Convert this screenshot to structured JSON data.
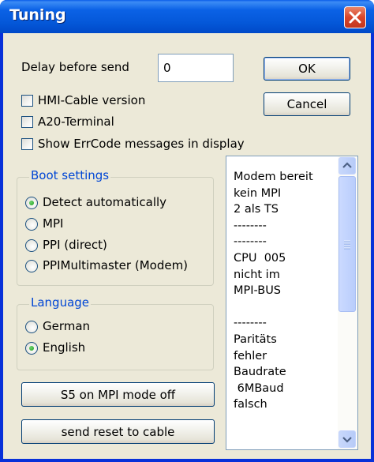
{
  "window": {
    "title": "Tuning"
  },
  "delay": {
    "label": "Delay before send",
    "value": "0"
  },
  "buttons": {
    "ok": "OK",
    "cancel": "Cancel",
    "s5": "S5 on MPI mode off",
    "reset": "send reset to cable"
  },
  "checkboxes": [
    {
      "label": "HMI-Cable version",
      "checked": false
    },
    {
      "label": "A20-Terminal",
      "checked": false
    },
    {
      "label": "Show ErrCode messages in display",
      "checked": false
    }
  ],
  "boot": {
    "title": "Boot settings",
    "options": [
      {
        "label": "Detect automatically",
        "selected": true
      },
      {
        "label": "MPI",
        "selected": false
      },
      {
        "label": "PPI (direct)",
        "selected": false
      },
      {
        "label": "PPIMultimaster (Modem)",
        "selected": false
      }
    ]
  },
  "language": {
    "title": "Language",
    "options": [
      {
        "label": "German",
        "selected": false
      },
      {
        "label": "English",
        "selected": true
      }
    ]
  },
  "messages": {
    "items": [
      "Modem bereit",
      "kein MPI",
      "2 als TS",
      "--------",
      "--------",
      "CPU  005",
      "nicht im",
      "MPI-BUS",
      "",
      "--------",
      "Paritäts",
      "fehler",
      "Baudrate",
      " 6MBaud",
      "falsch"
    ]
  },
  "icons": {
    "close": "close-icon",
    "scroll_up": "scroll-up-icon",
    "scroll_down": "scroll-down-icon",
    "grip": "scroll-grip-icon"
  },
  "colors": {
    "titlebar": "#0054e3",
    "groupTitle": "#0046d5",
    "face": "#ece9d8",
    "radioDot": "#21a121"
  }
}
